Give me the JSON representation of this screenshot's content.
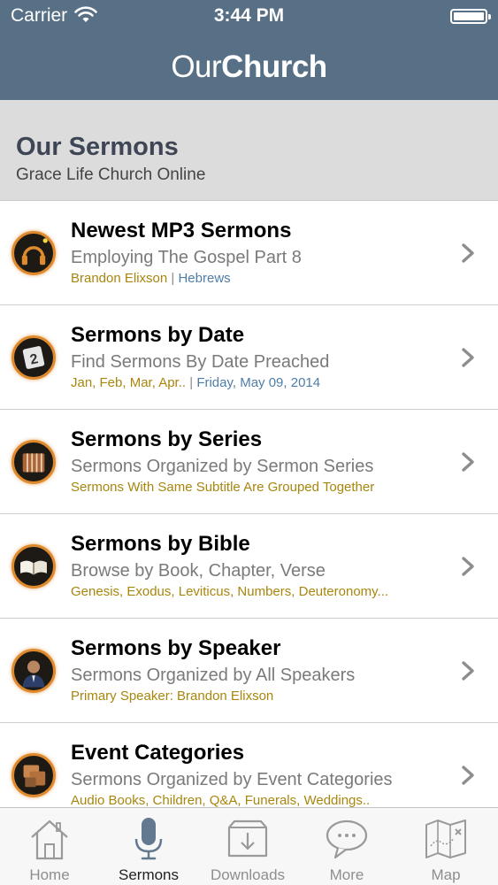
{
  "status_bar": {
    "carrier": "Carrier",
    "time": "3:44 PM"
  },
  "brand": {
    "part1": "Our",
    "part2": "Church"
  },
  "section": {
    "title": "Our Sermons",
    "subtitle": "Grace Life Church Online"
  },
  "rows": [
    {
      "title": "Newest MP3 Sermons",
      "subtitle": "Employing The Gospel Part 8",
      "meta_a": "Brandon Elixson",
      "sep": " | ",
      "meta_b": "Hebrews",
      "icon": "headphones-icon"
    },
    {
      "title": "Sermons by Date",
      "subtitle": "Find Sermons By Date Preached",
      "meta_a": "Jan, Feb, Mar, Apr..",
      "sep": " | ",
      "meta_b": "Friday, May 09, 2014",
      "icon": "calendar-icon"
    },
    {
      "title": "Sermons by Series",
      "subtitle": "Sermons Organized by Sermon Series",
      "meta_a": "Sermons With Same Subtitle Are Grouped Together",
      "sep": "",
      "meta_b": "",
      "icon": "book-stack-icon"
    },
    {
      "title": "Sermons by Bible",
      "subtitle": "Browse by Book, Chapter, Verse",
      "meta_a": "Genesis, Exodus, Leviticus, Numbers, Deuteronomy...",
      "sep": "",
      "meta_b": "",
      "icon": "open-bible-icon"
    },
    {
      "title": "Sermons by Speaker",
      "subtitle": "Sermons Organized by All Speakers",
      "meta_a": "Primary Speaker: Brandon Elixson",
      "sep": "",
      "meta_b": "",
      "icon": "speaker-icon"
    },
    {
      "title": "Event Categories",
      "subtitle": "Sermons Organized by Event Categories",
      "meta_a": "Audio Books, Children, Q&A, Funerals, Weddings..",
      "sep": "",
      "meta_b": "",
      "icon": "folder-icon"
    }
  ],
  "tabs": [
    {
      "label": "Home",
      "icon": "home-icon",
      "active": false
    },
    {
      "label": "Sermons",
      "icon": "microphone-icon",
      "active": true
    },
    {
      "label": "Downloads",
      "icon": "download-icon",
      "active": false
    },
    {
      "label": "More",
      "icon": "chat-bubble-icon",
      "active": false
    },
    {
      "label": "Map",
      "icon": "map-icon",
      "active": false
    }
  ],
  "colors": {
    "header": "#587085",
    "section_bg": "#dcdcdc",
    "meta_gold": "#a8860e",
    "meta_blue": "#4e7da8",
    "icon_ring": "#e08a2e"
  }
}
